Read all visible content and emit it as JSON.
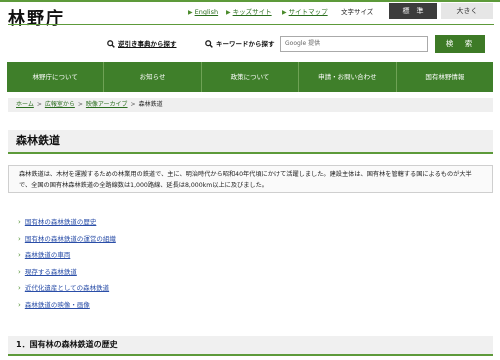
{
  "header": {
    "logo": "林野庁",
    "util_links": [
      {
        "label": "English"
      },
      {
        "label": "キッズサイト"
      },
      {
        "label": "サイトマップ"
      }
    ],
    "font_size_label": "文字サイズ",
    "font_size_options": [
      "標　準",
      "大きく"
    ],
    "font_size_selected": "標　準"
  },
  "search": {
    "index_label": "逆引き事典から探す",
    "keyword_label": "キーワードから探す",
    "input_value": "Google 提供",
    "button_label": "検　索"
  },
  "nav": {
    "items": [
      "林野庁について",
      "お知らせ",
      "政策について",
      "申請・お問い合わせ",
      "国有林野情報"
    ]
  },
  "breadcrumb": {
    "items": [
      "ホーム",
      "広報室から",
      "映像アーカイブ"
    ],
    "current": "森林鉄道",
    "separator": ">"
  },
  "main": {
    "title": "森林鉄道",
    "intro": "森林鉄道は、木材を運搬するための林業用の鉄道で、主に、明治時代から昭和40年代頃にかけて活躍しました。建設主体は、国有林を管轄する国によるものが大半で、全国の国有林森林鉄道の全路線数は1,000路線、延長は8,000km以上に及びました。",
    "toc": [
      "国有林の森林鉄道の歴史",
      "国有林の森林鉄道の運営の組織",
      "森林鉄道の車両",
      "現存する森林鉄道",
      "近代化遺産としての森林鉄道",
      "森林鉄道の映像・画像"
    ],
    "section_heading": "1．国有林の森林鉄道の歴史"
  },
  "colors": {
    "brand_green": "#3f7f2a",
    "accent_line": "#5d9a3a",
    "link_green": "#2a6e1e",
    "link_blue": "#2a4ea8"
  }
}
